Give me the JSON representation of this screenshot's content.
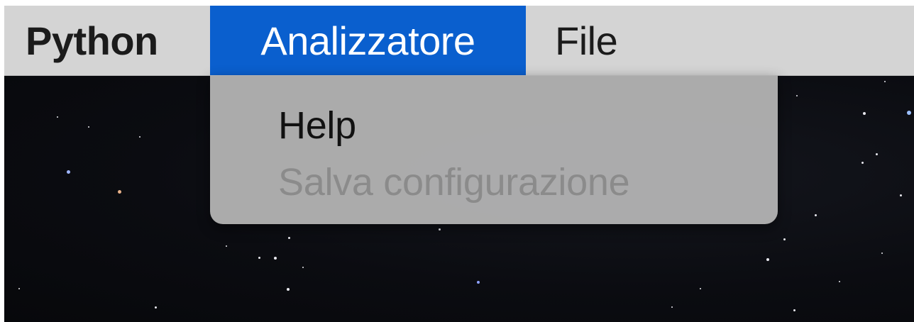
{
  "menubar": {
    "app_name": "Python",
    "active_menu": "Analizzatore",
    "file_menu": "File"
  },
  "dropdown": {
    "items": [
      {
        "label": "Help",
        "enabled": true
      },
      {
        "label": "Salva configurazione",
        "enabled": false
      }
    ]
  },
  "colors": {
    "menubar_bg": "#d4d4d4",
    "active_highlight": "#0a5fce",
    "dropdown_bg": "#b2b2b2",
    "disabled_text": "#8b8b8b",
    "desktop_bg": "#0b0c11"
  }
}
